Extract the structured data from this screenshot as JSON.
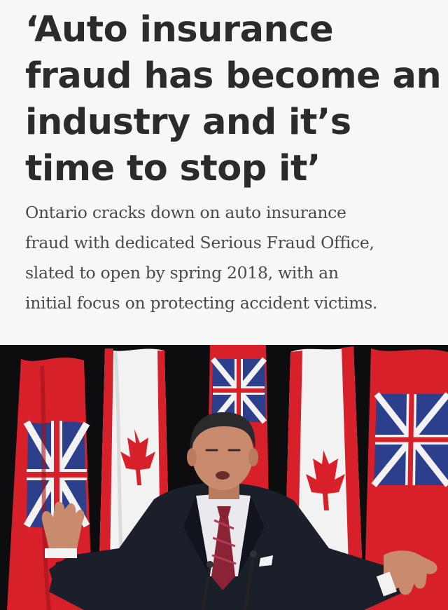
{
  "article": {
    "headline_lines": [
      "‘Auto insurance",
      "fraud has become an",
      "industry and it’s",
      "time to stop it’"
    ],
    "dek_lines": [
      "Ontario cracks down on auto insurance",
      "fraud with dedicated Serious Fraud Office,",
      "slated to open by spring 2018, with an",
      "initial focus on protecting accident victims."
    ]
  },
  "photo": {
    "subject": "speaker-at-podium-with-flags",
    "colors": {
      "background": "#0d0d0f",
      "flag_red": "#d8202a",
      "flag_white": "#f2f2f2",
      "flag_blue": "#2b3f8c",
      "suit": "#1b1f2a",
      "shirt": "#e9e9ee",
      "tie": "#8a2336",
      "skin": "#c98b6e",
      "hair": "#2a2a2c"
    }
  }
}
